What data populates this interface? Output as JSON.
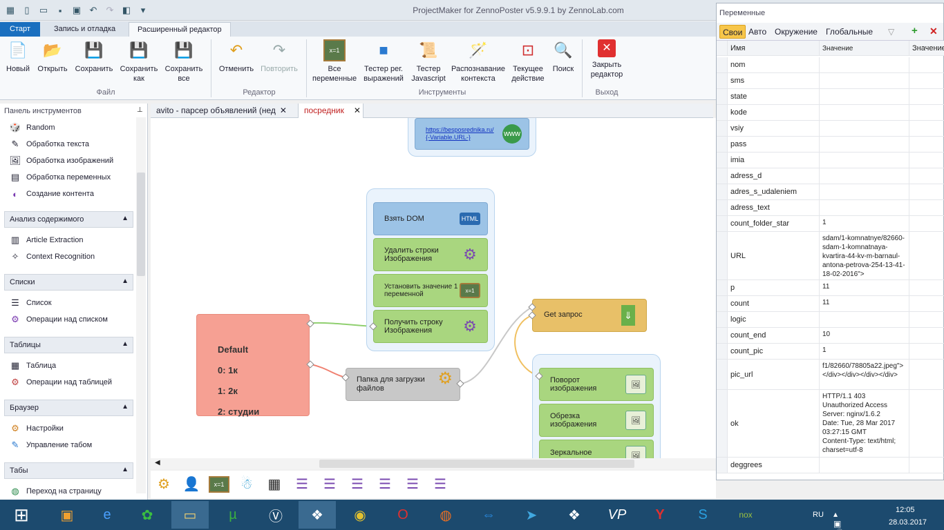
{
  "app": {
    "title": "ProjectMaker for ZennoPoster v5.9.9.1 by ZennoLab.com"
  },
  "ribbon_tabs": [
    "Старт",
    "Запись и отладка",
    "Расширенный редактор"
  ],
  "ribbon": {
    "new": "Новый",
    "open": "Открыть",
    "save": "Сохранить",
    "save_as": "Сохранить как",
    "save_all": "Сохранить все",
    "undo": "Отменить",
    "redo": "Повторить",
    "all_vars": "Все переменные",
    "regex": "Тестер рег. выражений",
    "js": "Тестер Javascript",
    "ctx": "Распознавание контекста",
    "cur": "Текущее действие",
    "search": "Поиск",
    "close": "Закрыть редактор",
    "groups": {
      "file": "Файл",
      "editor": "Редактор",
      "tools": "Инструменты",
      "exit": "Выход"
    }
  },
  "left_panel": {
    "title": "Панель инструментов",
    "items_top": [
      "Random",
      "Обработка текста",
      "Обработка изображений",
      "Обработка переменных",
      "Создание контента"
    ],
    "sections": [
      {
        "title": "Анализ содержимого",
        "items": [
          "Article Extraction",
          "Context Recognition"
        ]
      },
      {
        "title": "Списки",
        "items": [
          "Список",
          "Операции над списком"
        ]
      },
      {
        "title": "Таблицы",
        "items": [
          "Таблица",
          "Операции над таблицей"
        ]
      },
      {
        "title": "Браузер",
        "items": [
          "Настройки",
          "Управление табом"
        ]
      },
      {
        "title": "Табы",
        "items": [
          "Переход на страницу"
        ]
      }
    ]
  },
  "doc_tabs": [
    "avito - парсер объявлений (нед",
    "посредник"
  ],
  "canvas": {
    "url_block": "https://besposrednika.ru/{-Variable.URL-}",
    "dom": "Взять DOM",
    "del_rows": "Удалить строки Изображения",
    "set_val": "Установить значение 1 переменной",
    "get_row": "Получить строку Изображения",
    "get_req": "Get запрос",
    "folder": "Папка для загрузки файлов",
    "rotate": "Поворот изображения",
    "crop": "Обрезка изображения",
    "mirror": "Зеркальное",
    "switch": {
      "title": "Default",
      "c0": "0: 1к",
      "c1": "1: 2к",
      "c2": "2: студии"
    }
  },
  "variables": {
    "title": "Переменные",
    "tabs": [
      "Свои",
      "Авто",
      "Окружение",
      "Глобальные"
    ],
    "headers": [
      "Имя",
      "Значение",
      "Значение"
    ],
    "rows": [
      {
        "name": "nom",
        "value": ""
      },
      {
        "name": "sms",
        "value": ""
      },
      {
        "name": "state",
        "value": ""
      },
      {
        "name": "kode",
        "value": ""
      },
      {
        "name": "vsiy",
        "value": ""
      },
      {
        "name": "pass",
        "value": ""
      },
      {
        "name": "imia",
        "value": ""
      },
      {
        "name": "adress_d",
        "value": ""
      },
      {
        "name": "adres_s_udaleniem",
        "value": ""
      },
      {
        "name": "adress_text",
        "value": ""
      },
      {
        "name": "count_folder_star",
        "value": "1"
      },
      {
        "name": "URL",
        "value": "sdam/1-komnatnye/82660-sdam-1-komnatnaya-kvartira-44-kv-m-barnaul-antona-petrova-254-13-41-18-02-2016\">"
      },
      {
        "name": "p",
        "value": "11"
      },
      {
        "name": "count",
        "value": "11"
      },
      {
        "name": "logic",
        "value": ""
      },
      {
        "name": "count_end",
        "value": "10"
      },
      {
        "name": "count_pic",
        "value": "1"
      },
      {
        "name": "pic_url",
        "value": "f1/82660/78805a22.jpeg\"></div></div></div></div>"
      },
      {
        "name": "ok",
        "value": "HTTP/1.1 403\nUnauthorized Access\nServer: nginx/1.6.2\nDate: Tue, 28 Mar 2017\n03:27:15 GMT\nContent-Type: text/html;\ncharset=utf-8"
      },
      {
        "name": "deggrees",
        "value": ""
      }
    ]
  },
  "taskbar": {
    "lang": "RU",
    "time": "12:05",
    "date": "28.03.2017"
  }
}
